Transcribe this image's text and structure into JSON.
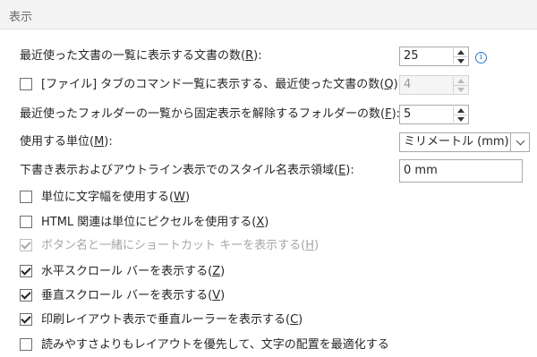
{
  "section": {
    "title": "表示"
  },
  "options": {
    "recent_docs": {
      "label": "最近使った文書の一覧に表示する文書の数(",
      "key": "R",
      "suffix": "):",
      "value": "25"
    },
    "quick_access": {
      "label": "[ファイル] タブのコマンド一覧に表示する、最近使った文書の数(",
      "key": "Q",
      "suffix": "):",
      "value": "4",
      "checked": false
    },
    "recent_folders": {
      "label": "最近使ったフォルダーの一覧から固定表示を解除するフォルダーの数(",
      "key": "F",
      "suffix": "):",
      "value": "5"
    },
    "units": {
      "label": "使用する単位(",
      "key": "M",
      "suffix": "):",
      "value": "ミリメートル (mm)"
    },
    "style_area": {
      "label": "下書き表示およびアウトライン表示でのスタイル名表示領域(",
      "key": "E",
      "suffix": "):",
      "value": "0 mm"
    }
  },
  "checkboxes": [
    {
      "label": "単位に文字幅を使用する(",
      "key": "W",
      "suffix": ")",
      "checked": false,
      "disabled": false
    },
    {
      "label": "HTML 関連は単位にピクセルを使用する(",
      "key": "X",
      "suffix": ")",
      "checked": false,
      "disabled": false
    },
    {
      "label": "ボタン名と一緒にショートカット キーを表示する(",
      "key": "H",
      "suffix": ")",
      "checked": true,
      "disabled": true
    },
    {
      "label": "水平スクロール バーを表示する(",
      "key": "Z",
      "suffix": ")",
      "checked": true,
      "disabled": false
    },
    {
      "label": "垂直スクロール バーを表示する(",
      "key": "V",
      "suffix": ")",
      "checked": true,
      "disabled": false
    },
    {
      "label": "印刷レイアウト表示で垂直ルーラーを表示する(",
      "key": "C",
      "suffix": ")",
      "checked": true,
      "disabled": false
    },
    {
      "label": "読みやすさよりもレイアウトを優先して、文字の配置を最適化する",
      "key": "",
      "suffix": "",
      "checked": false,
      "disabled": false
    }
  ],
  "icons": {
    "info": "info-icon",
    "spin_up": "arrow-up-icon",
    "spin_down": "arrow-down-icon",
    "dropdown": "chevron-down-icon"
  },
  "colors": {
    "header_bg": "#f3f3f3",
    "info_blue": "#2a7bd4",
    "disabled_text": "#a6a6a6"
  }
}
